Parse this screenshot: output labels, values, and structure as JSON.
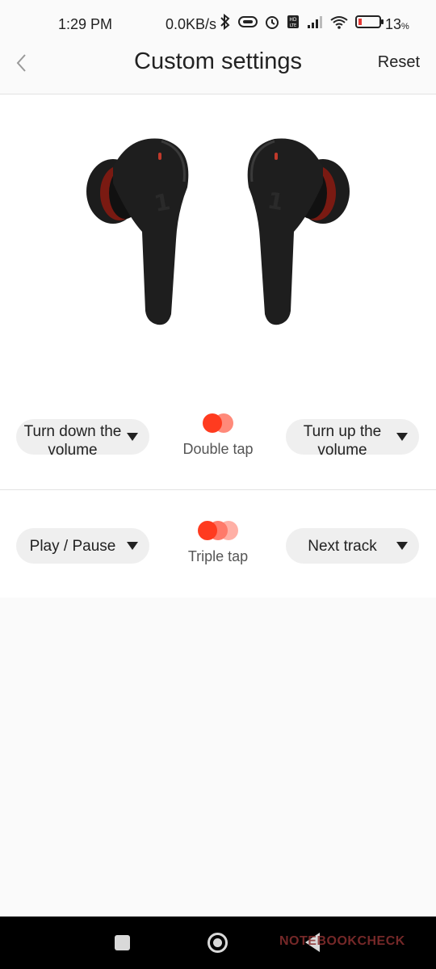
{
  "status_bar": {
    "time": "1:29 PM",
    "network_speed": "0.0KB/s",
    "battery_percent": "13",
    "battery_unit": "%",
    "icons": [
      "bluetooth-icon",
      "link-icon",
      "alarm-icon",
      "volte-icon",
      "signal-icon",
      "wifi-icon",
      "battery-icon"
    ]
  },
  "header": {
    "title": "Custom settings",
    "reset_label": "Reset"
  },
  "controls": {
    "double_tap": {
      "caption": "Double tap",
      "left_action": "Turn down the volume",
      "right_action": "Turn up the volume"
    },
    "triple_tap": {
      "caption": "Triple tap",
      "left_action": "Play / Pause",
      "right_action": "Next track"
    }
  },
  "colors": {
    "accent": "#ff3b1f",
    "accent_light": "#ff7a6a",
    "accent_lighter": "#ffb0a6"
  },
  "watermark": "NOTEBOOKCHECK"
}
